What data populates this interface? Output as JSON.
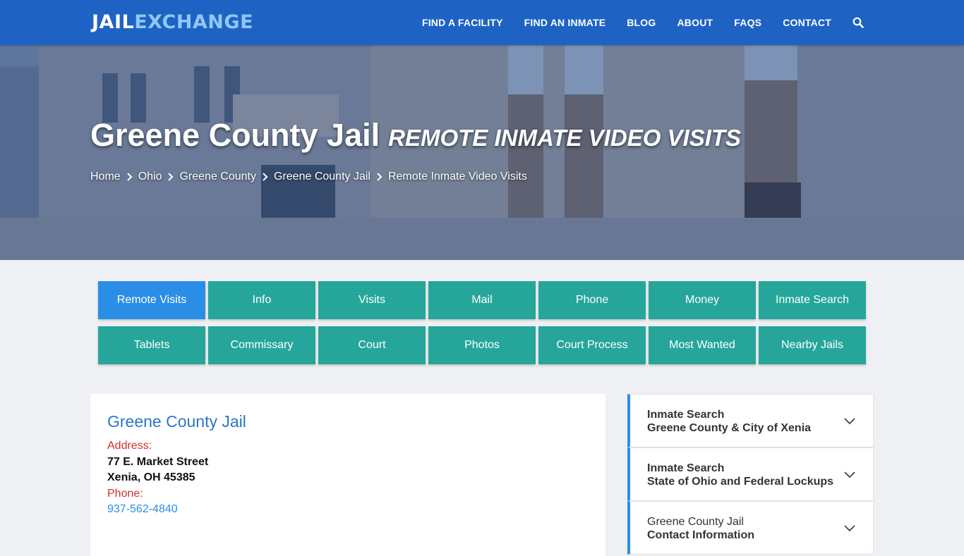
{
  "header": {
    "logo_part1": "JAIL",
    "logo_part2": "EXCHANGE",
    "nav": [
      "FIND A FACILITY",
      "FIND AN INMATE",
      "BLOG",
      "ABOUT",
      "FAQs",
      "CONTACT"
    ],
    "search_icon": "search-icon"
  },
  "hero": {
    "title": "Greene County Jail",
    "subtitle": "REMOTE INMATE VIDEO VISITS",
    "breadcrumb": [
      "Home",
      "Ohio",
      "Greene County",
      "Greene County Jail",
      "Remote Inmate Video Visits"
    ]
  },
  "buttons": {
    "row1": [
      "Remote Visits",
      "Info",
      "Visits",
      "Mail",
      "Phone",
      "Money",
      "Inmate Search"
    ],
    "row2": [
      "Tablets",
      "Commissary",
      "Court",
      "Photos",
      "Court Process",
      "Most Wanted",
      "Nearby Jails"
    ],
    "active": "Remote Visits"
  },
  "facility": {
    "name": "Greene County Jail",
    "address_label": "Address:",
    "street": "77 E. Market Street",
    "city": "Xenia, OH 45385",
    "phone_label": "Phone:",
    "phone": "937-562-4840"
  },
  "sidebar": [
    {
      "line1": "Inmate Search",
      "line2": "Greene County & City of Xenia"
    },
    {
      "line1": "Inmate Search",
      "line2": "State of Ohio and Federal Lockups"
    },
    {
      "line1": "Greene County Jail",
      "line2": "Contact Information"
    }
  ],
  "colors": {
    "header_bg": "#1e63c4",
    "accent_teal": "#26a69a",
    "active_blue": "#2b8ee6",
    "label_red": "#d32f2f",
    "title_blue": "#2b76c8"
  }
}
